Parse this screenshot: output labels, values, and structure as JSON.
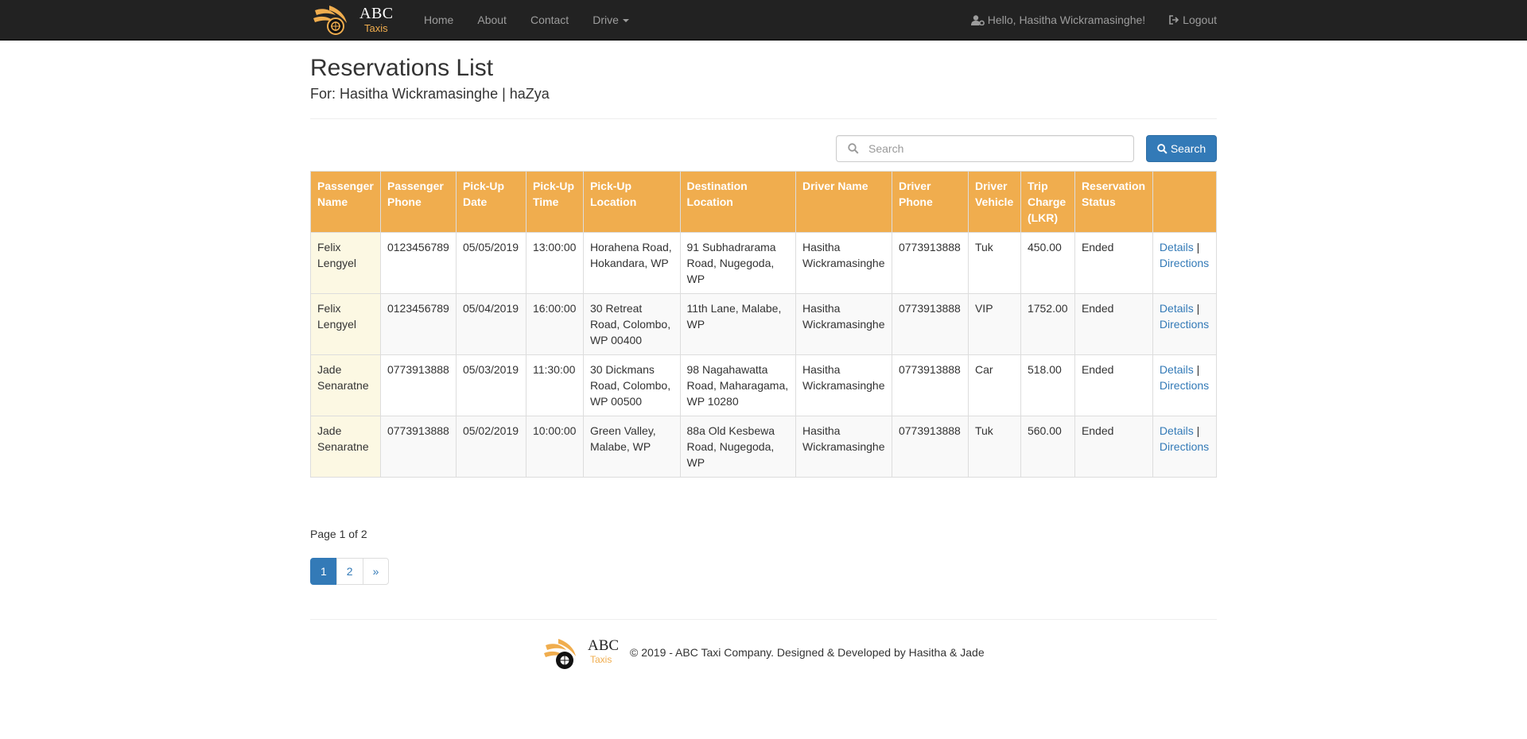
{
  "brand": {
    "abc": "ABC",
    "taxis": "Taxis",
    "accent_color": "#f0ad4e"
  },
  "nav": {
    "links": [
      "Home",
      "About",
      "Contact",
      "Drive"
    ],
    "greeting": "Hello, Hasitha Wickramasinghe!",
    "logout": "Logout"
  },
  "page": {
    "title": "Reservations List",
    "subtitle": "For: Hasitha Wickramasinghe | haZya"
  },
  "search": {
    "placeholder": "Search",
    "value": "",
    "button_label": "Search"
  },
  "table": {
    "headers": [
      "Passenger Name",
      "Passenger Phone",
      "Pick-Up Date",
      "Pick-Up Time",
      "Pick-Up Location",
      "Destination Location",
      "Driver Name",
      "Driver Phone",
      "Driver Vehicle",
      "Trip Charge (LKR)",
      "Reservation Status",
      ""
    ],
    "rows": [
      [
        "Felix Lengyel",
        "0123456789",
        "05/05/2019",
        "13:00:00",
        "Horahena Road, Hokandara, WP",
        "91 Subhadrarama Road, Nugegoda, WP",
        "Hasitha Wickramasinghe",
        "0773913888",
        "Tuk",
        "450.00",
        "Ended"
      ],
      [
        "Felix Lengyel",
        "0123456789",
        "05/04/2019",
        "16:00:00",
        "30 Retreat Road, Colombo, WP 00400",
        "11th Lane, Malabe, WP",
        "Hasitha Wickramasinghe",
        "0773913888",
        "VIP",
        "1752.00",
        "Ended"
      ],
      [
        "Jade Senaratne",
        "0773913888",
        "05/03/2019",
        "11:30:00",
        "30 Dickmans Road, Colombo, WP 00500",
        "98 Nagahawatta Road, Maharagama, WP 10280",
        "Hasitha Wickramasinghe",
        "0773913888",
        "Car",
        "518.00",
        "Ended"
      ],
      [
        "Jade Senaratne",
        "0773913888",
        "05/02/2019",
        "10:00:00",
        "Green Valley, Malabe, WP",
        "88a Old Kesbewa Road, Nugegoda, WP",
        "Hasitha Wickramasinghe",
        "0773913888",
        "Tuk",
        "560.00",
        "Ended"
      ]
    ],
    "action_details": "Details",
    "action_sep": "|",
    "action_directions": "Directions"
  },
  "pagination": {
    "info": "Page 1 of 2",
    "pages": [
      "1",
      "2",
      "»"
    ],
    "current": "1"
  },
  "footer": {
    "abc": "ABC",
    "taxis": "Taxis",
    "text": "© 2019 - ABC Taxi Company. Designed & Developed by Hasitha & Jade"
  }
}
